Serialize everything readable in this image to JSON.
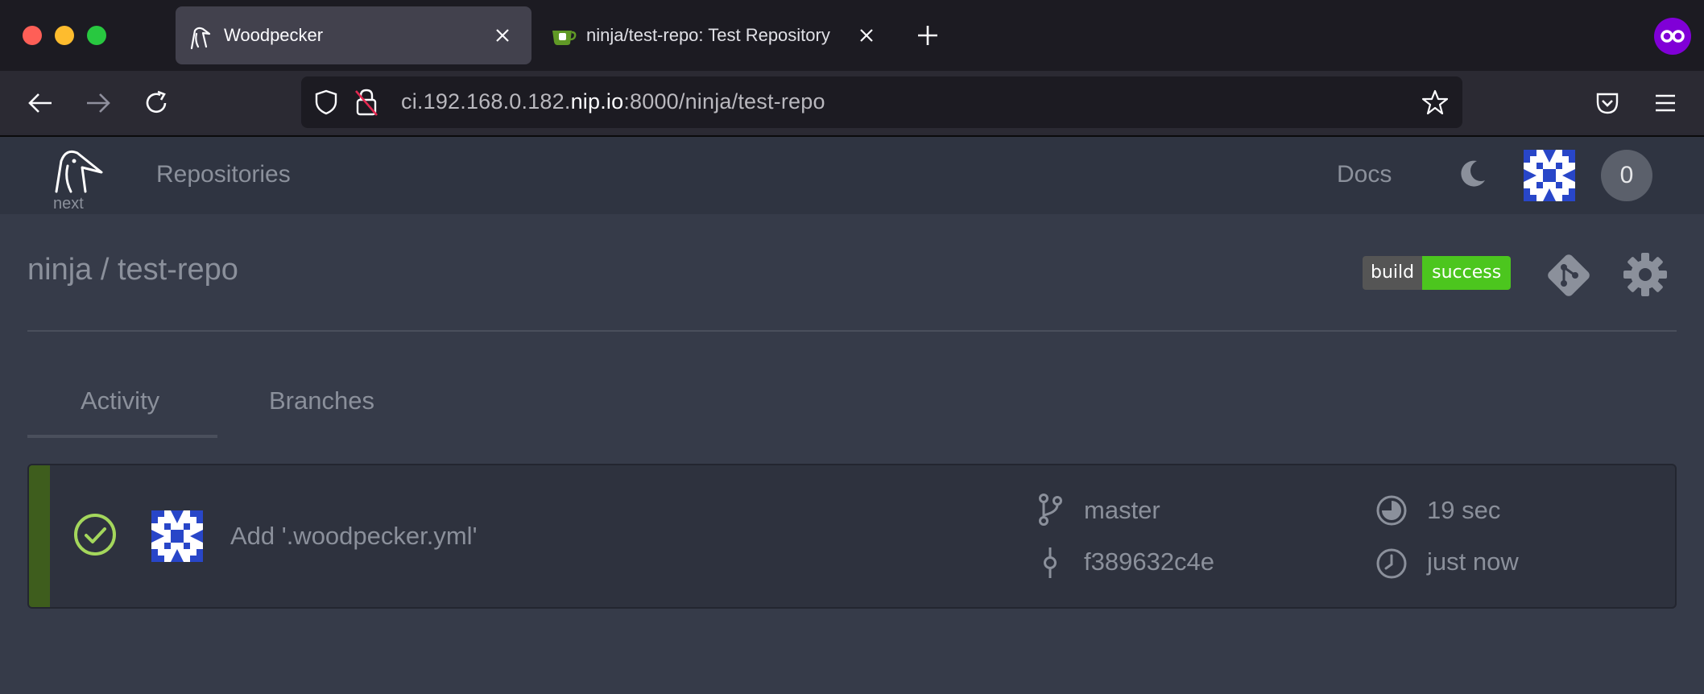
{
  "browser": {
    "tabs": [
      {
        "title": "Woodpecker",
        "active": true
      },
      {
        "title": "ninja/test-repo: Test Repository",
        "active": false
      }
    ],
    "url": {
      "prefix": "ci.192.168.0.182.",
      "host": "nip.io",
      "suffix": ":8000/ninja/test-repo"
    },
    "accent_color": "#8000d7"
  },
  "app": {
    "logo_caption": "next",
    "nav": {
      "repositories": "Repositories",
      "docs": "Docs",
      "notification_count": "0"
    },
    "repo": {
      "title": "ninja / test-repo",
      "badge_label": "build",
      "badge_status": "success",
      "badge_color": "#4cc61e"
    },
    "tabs": [
      "Activity",
      "Branches"
    ],
    "pipelines": [
      {
        "status": "success",
        "message": "Add '.woodpecker.yml'",
        "branch": "master",
        "commit": "f389632c4e",
        "duration": "19 sec",
        "created": "just now"
      }
    ]
  }
}
